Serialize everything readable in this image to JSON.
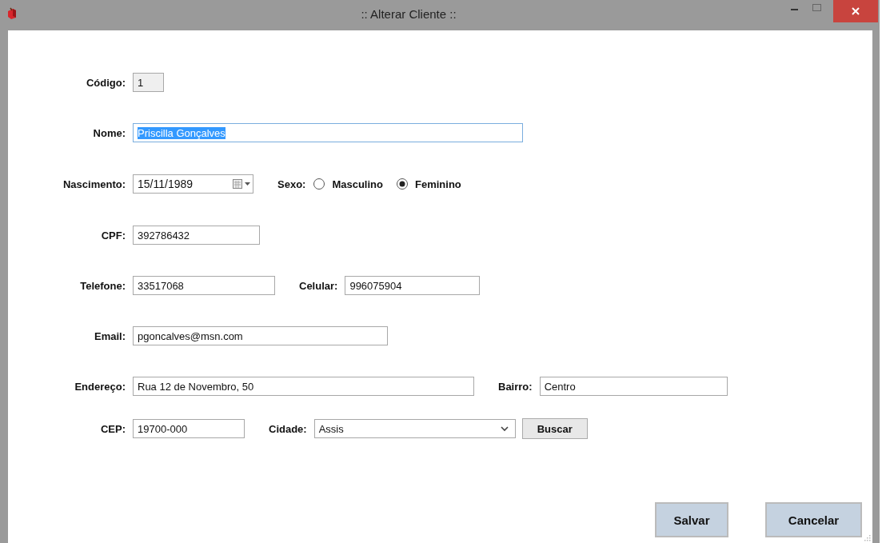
{
  "window": {
    "title": ":: Alterar Cliente ::"
  },
  "rows": [
    {
      "items": [
        {
          "kind": "text",
          "label": "Código:",
          "value": "1",
          "disabled": true,
          "text_selected": false
        }
      ]
    },
    {
      "items": [
        {
          "kind": "text",
          "label": "Nome:",
          "value": "Priscilla Gonçalves",
          "disabled": false,
          "text_selected": true
        }
      ]
    },
    {
      "items": [
        {
          "kind": "date",
          "label": "Nascimento:",
          "value": "15/11/1989"
        },
        {
          "kind": "radio",
          "label": "Sexo:",
          "options": [
            {
              "label": "Masculino",
              "selected": false
            },
            {
              "label": "Feminino",
              "selected": true
            }
          ]
        }
      ]
    },
    {
      "items": [
        {
          "kind": "text",
          "label": "CPF:",
          "value": "392786432",
          "disabled": false,
          "text_selected": false
        }
      ]
    },
    {
      "items": [
        {
          "kind": "text",
          "label": "Telefone:",
          "value": "33517068",
          "disabled": false,
          "text_selected": false
        },
        {
          "kind": "text",
          "label": "Celular:",
          "value": "996075904",
          "disabled": false,
          "text_selected": false
        }
      ]
    },
    {
      "items": [
        {
          "kind": "text",
          "label": "Email:",
          "value": "pgoncalves@msn.com",
          "disabled": false,
          "text_selected": false
        }
      ]
    },
    {
      "items": [
        {
          "kind": "text",
          "label": "Endereço:",
          "value": "Rua 12 de Novembro, 50",
          "disabled": false,
          "text_selected": false
        },
        {
          "kind": "text",
          "label": "Bairro:",
          "value": "Centro",
          "disabled": false,
          "text_selected": false
        }
      ]
    },
    {
      "items": [
        {
          "kind": "text",
          "label": "CEP:",
          "value": "19700-000",
          "disabled": false,
          "text_selected": false
        },
        {
          "kind": "combo",
          "label": "Cidade:",
          "value": "Assis"
        },
        {
          "kind": "button",
          "label": "Buscar"
        }
      ]
    }
  ],
  "buttons": [
    {
      "label": "Salvar"
    },
    {
      "label": "Cancelar"
    }
  ]
}
